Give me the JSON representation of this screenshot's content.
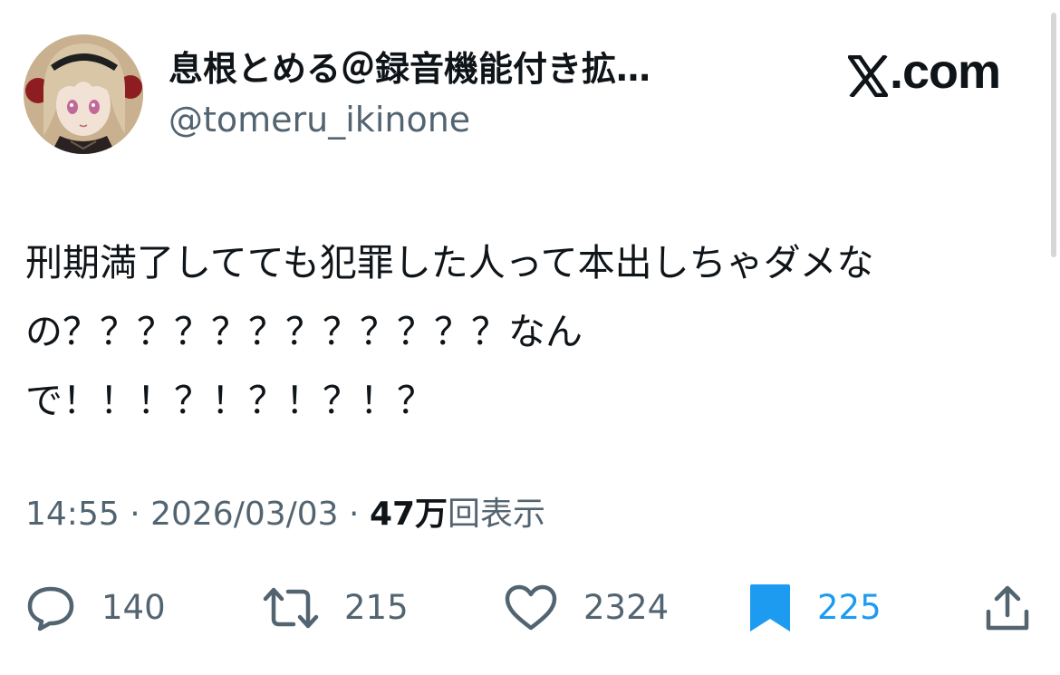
{
  "author": {
    "display_name": "息根とめる＠録音機能付き拡…",
    "handle": "@tomeru_ikinone"
  },
  "brand": {
    "label": ".com",
    "logo_icon": "x-logo-icon"
  },
  "tweet": {
    "lines": [
      "刑期満了してても犯罪した人って本出しちゃダメな",
      "の？？？？？？？？？？？？なん",
      "で！！！？！？！？！？"
    ]
  },
  "meta": {
    "time": "14:55",
    "separator": " · ",
    "date": "2026/03/03",
    "views_count": "47万",
    "views_label": "回表示"
  },
  "actions": {
    "reply": {
      "icon": "reply-icon",
      "count": "140"
    },
    "repost": {
      "icon": "repost-icon",
      "count": "215"
    },
    "like": {
      "icon": "heart-icon",
      "count": "2324"
    },
    "bookmark": {
      "icon": "bookmark-icon",
      "count": "225",
      "active": true
    },
    "share": {
      "icon": "share-icon"
    }
  },
  "colors": {
    "text_primary": "#0f1419",
    "text_secondary": "#536471",
    "accent_blue": "#1d9bf0"
  }
}
